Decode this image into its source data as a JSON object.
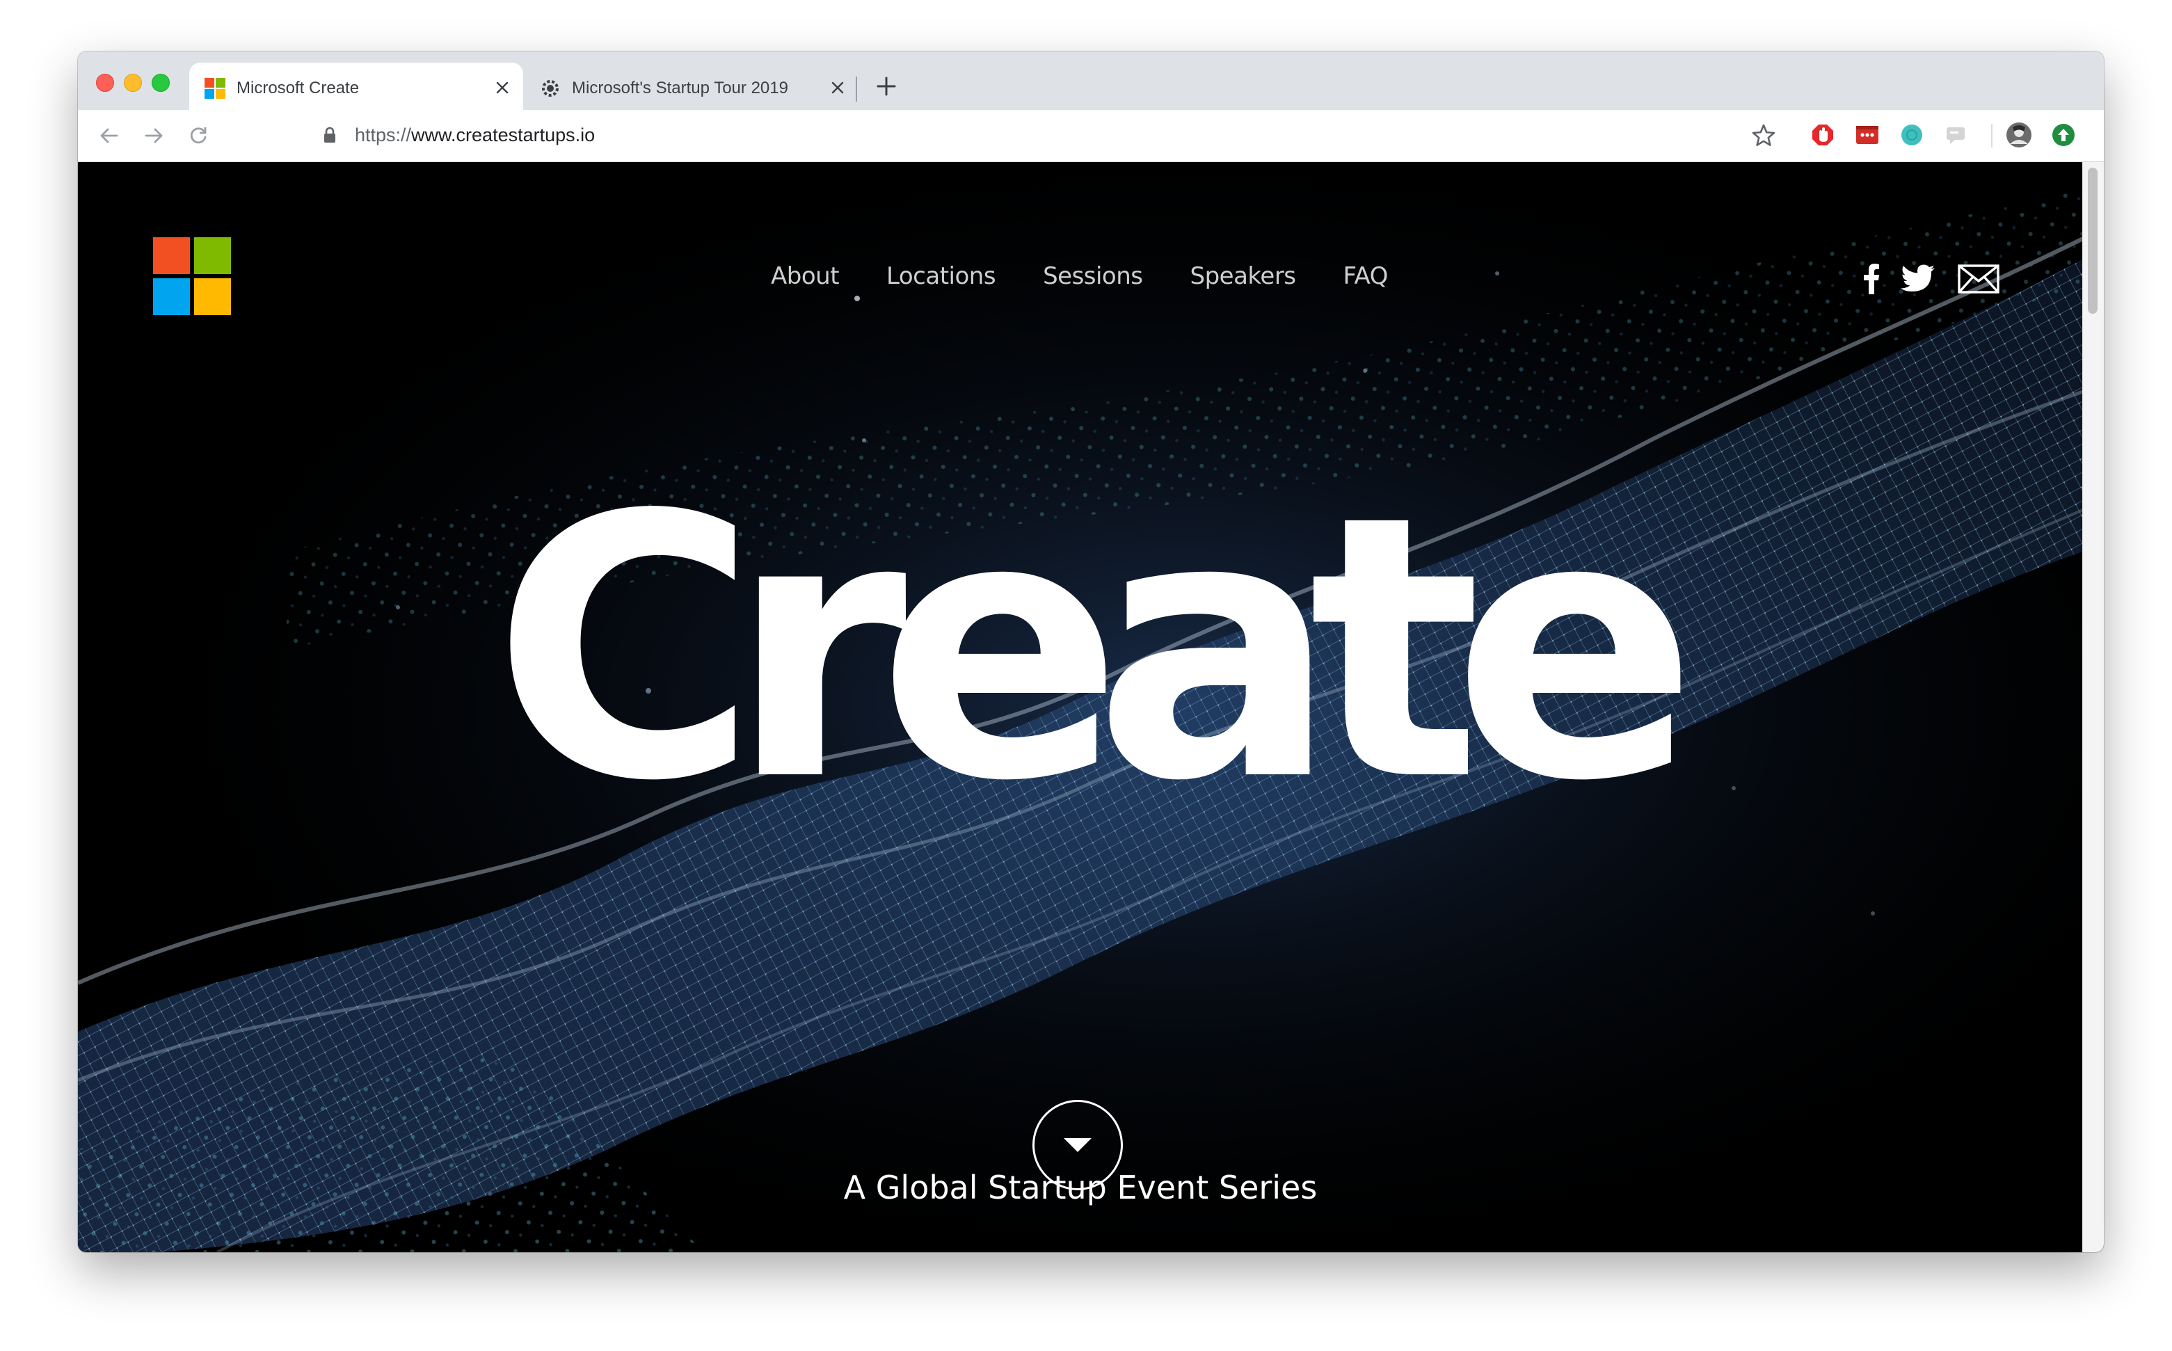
{
  "browser": {
    "tabs": [
      {
        "title": "Microsoft Create",
        "active": true
      },
      {
        "title": "Microsoft's Startup Tour 2019",
        "active": false
      }
    ],
    "address": {
      "scheme": "https://",
      "host": "www.createstartups.io"
    },
    "toolbar_icons": [
      "back-arrow-icon",
      "forward-arrow-icon",
      "reload-icon",
      "lock-icon",
      "star-icon"
    ],
    "extensions": [
      "adblock-icon",
      "lastpass-icon",
      "teal-circle-icon",
      "speech-bubble-icon",
      "profile-avatar",
      "update-arrow-icon"
    ]
  },
  "site": {
    "logo_colors": [
      "#f25022",
      "#7fba00",
      "#00a4ef",
      "#ffb900"
    ],
    "nav": [
      "About",
      "Locations",
      "Sessions",
      "Speakers",
      "FAQ"
    ],
    "social": [
      "facebook-icon",
      "twitter-icon",
      "mail-icon"
    ],
    "hero_title": "Create",
    "tagline": "A Global Startup Event Series"
  },
  "colors": {
    "hero_background": "#000000",
    "mesh_blue": "#2a4a7a",
    "mesh_teal": "#6fb6c7"
  }
}
